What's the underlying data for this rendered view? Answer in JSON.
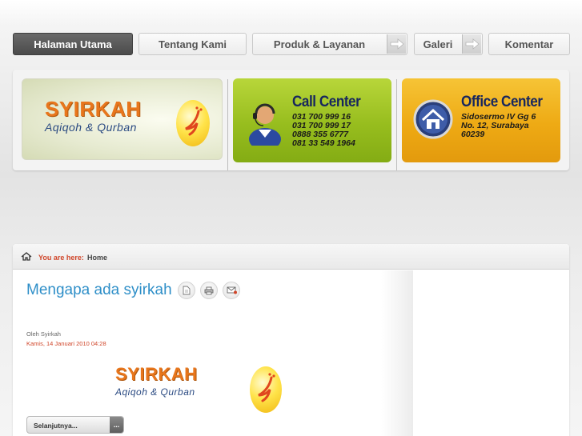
{
  "nav": {
    "items": [
      {
        "label": "Halaman Utama"
      },
      {
        "label": "Tentang Kami"
      },
      {
        "label": "Produk & Layanan"
      },
      {
        "label": "Galeri"
      },
      {
        "label": "Komentar"
      }
    ]
  },
  "banner": {
    "logo": {
      "name": "SYIRKAH",
      "tagline": "Aqiqoh & Qurban"
    },
    "call_center": {
      "title": "Call Center",
      "lines": [
        "031 700 999 16",
        "031 700 999 17",
        "0888 355 6777",
        "081 33 549 1964"
      ],
      "icon": "operator-headset-icon"
    },
    "office_center": {
      "title": "Office Center",
      "lines": [
        "Sidosermo IV Gg 6",
        "No. 12, Surabaya",
        "60239"
      ],
      "icon": "home-icon"
    }
  },
  "breadcrumb": {
    "label": "You are here:",
    "current": "Home"
  },
  "article": {
    "title": "Mengapa ada syirkah",
    "author": "Oleh Syirkah",
    "date": "Kamis, 14 Januari 2010 04:28",
    "logo": {
      "name": "SYIRKAH",
      "tagline": "Aqiqoh & Qurban"
    },
    "read_more": "Selanjutnya...",
    "read_more_dots": "..."
  },
  "colors": {
    "active_nav": "#555555",
    "link_blue": "#2f8fc8",
    "accent_red": "#d0462a",
    "call_green": "#97bd1e",
    "office_orange": "#eeaa14"
  }
}
